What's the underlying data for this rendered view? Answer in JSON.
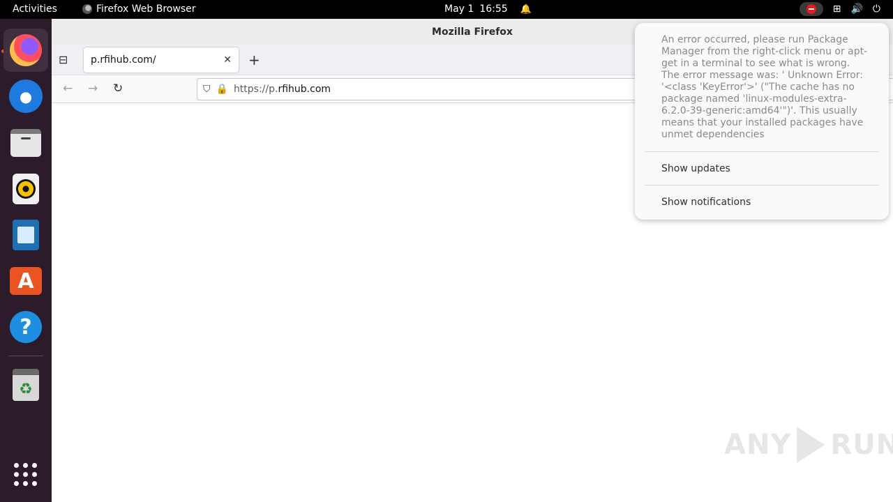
{
  "topbar": {
    "activities": "Activities",
    "app_name": "Firefox Web Browser",
    "date": "May 1",
    "time": "16:55"
  },
  "dock": {
    "items": [
      "Firefox",
      "Thunderbird",
      "Files",
      "Rhythmbox",
      "LibreOffice Writer",
      "Ubuntu Software",
      "Help",
      "Trash",
      "Show Applications"
    ]
  },
  "window": {
    "title": "Mozilla Firefox",
    "tab_title": "p.rfihub.com/",
    "url_protocol": "https://p.",
    "url_host": "rfihub.com"
  },
  "popup": {
    "message": "An error occurred, please run Package Manager from the right-click menu or apt-get in a terminal to see what is wrong.\nThe error message was: ' Unknown Error: '<class 'KeyError'>' (\"The cache has no package named 'linux-modules-extra-6.2.0-39-generic:amd64'\")'. This usually means that your installed packages have unmet dependencies",
    "show_updates": "Show updates",
    "show_notifications": "Show notifications"
  },
  "watermark": {
    "left": "ANY",
    "right": "RUN"
  },
  "colors": {
    "topbar": "#000000",
    "dock": "#2b1b2b",
    "accent": "#e95420",
    "error_red": "#e01b24"
  }
}
